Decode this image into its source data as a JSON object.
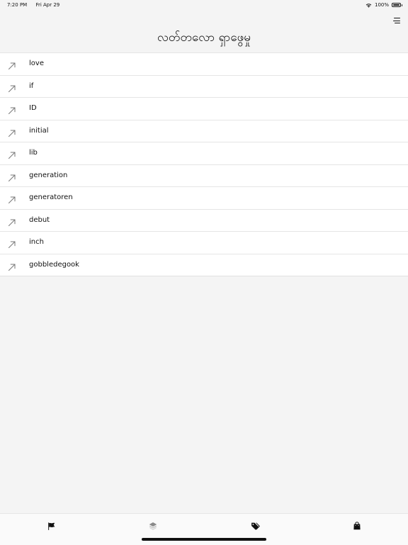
{
  "status_bar": {
    "time": "7:20 PM",
    "date": "Fri Apr 29",
    "battery": "100%",
    "battery_level": 1.0
  },
  "header": {
    "title": "လတ်တလော ရှာဖွေမှု",
    "menu_icon": "menu-lines-icon"
  },
  "recent_searches": [
    {
      "label": "love",
      "icon": "arrow-up-right-icon"
    },
    {
      "label": "if",
      "icon": "arrow-up-right-icon"
    },
    {
      "label": "ID",
      "icon": "arrow-up-right-icon"
    },
    {
      "label": "initial",
      "icon": "arrow-up-right-icon"
    },
    {
      "label": "lib",
      "icon": "arrow-up-right-icon"
    },
    {
      "label": "generation",
      "icon": "arrow-up-right-icon"
    },
    {
      "label": "generatoren",
      "icon": "arrow-up-right-icon"
    },
    {
      "label": "debut",
      "icon": "arrow-up-right-icon"
    },
    {
      "label": "inch",
      "icon": "arrow-up-right-icon"
    },
    {
      "label": "gobbledegook",
      "icon": "arrow-up-right-icon"
    }
  ],
  "tab_bar": {
    "tabs": [
      {
        "icon": "flag-icon",
        "active": false
      },
      {
        "icon": "layers-icon",
        "active": false
      },
      {
        "icon": "tag-icon",
        "active": true
      },
      {
        "icon": "shopping-bag-icon",
        "active": false
      }
    ]
  },
  "colors": {
    "background": "#f4f4f4",
    "list_background": "#ffffff",
    "text": "#111111",
    "icon_muted": "#777777",
    "divider": "#e5e5e5"
  }
}
